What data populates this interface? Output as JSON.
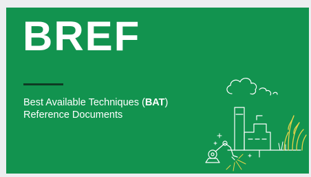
{
  "banner": {
    "title": "BREF",
    "subtitle_line1_prefix": "Best Available Techniques (",
    "subtitle_line1_bold": "BAT",
    "subtitle_line1_suffix": ")",
    "subtitle_line2": "Reference Documents",
    "colors": {
      "background": "#12934f",
      "text": "#ffffff",
      "rule": "#0e3b23",
      "illustration_accent": "#e8d44a"
    },
    "illustration": {
      "icon": "industry-environment-illustration",
      "elements": [
        "cloud-icon",
        "factory-chimney-icon",
        "factory-building-icon",
        "robot-arm-icon",
        "reeds-plant-icon"
      ]
    }
  }
}
